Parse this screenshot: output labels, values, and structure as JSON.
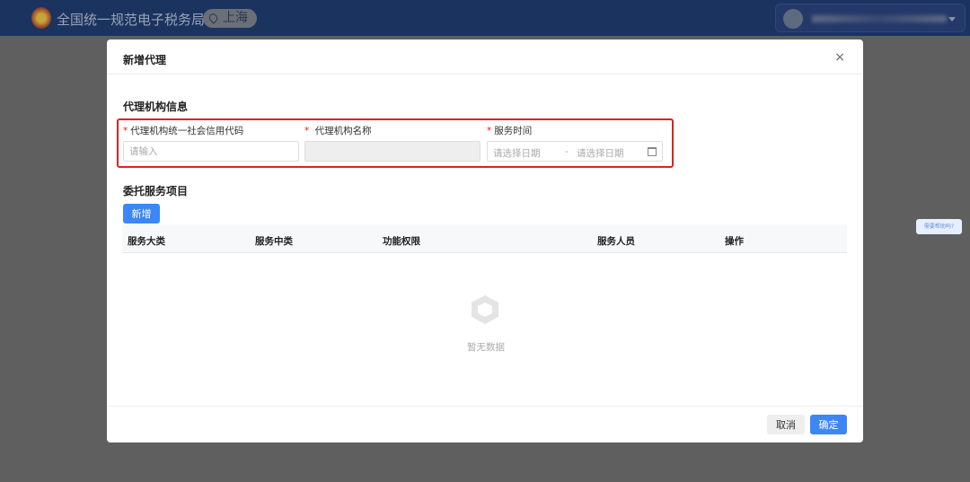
{
  "header": {
    "app_title": "全国统一规范电子税务局",
    "region": "上海",
    "user_name": ""
  },
  "modal": {
    "title": "新增代理",
    "close_label": "×",
    "agency_section": "代理机构信息",
    "fields": [
      {
        "label": "代理机构统一社会信用代码",
        "required": true,
        "placeholder": "请输入",
        "value": ""
      },
      {
        "label": "代理机构名称",
        "required": true,
        "value": "",
        "disabled": true
      },
      {
        "label": "服务时间",
        "required": true,
        "start_placeholder": "请选择日期",
        "separator": "-",
        "end_placeholder": "请选择日期"
      }
    ],
    "service_section": "委托服务项目",
    "add_button": "新增",
    "table": {
      "columns": [
        "服务大类",
        "服务中类",
        "功能权限",
        "服务人员",
        "操作"
      ],
      "rows": [],
      "empty_text": "暂无数据"
    },
    "cancel_button": "取消",
    "confirm_button": "确定"
  },
  "help_tooltip": "需要帮助吗?",
  "colors": {
    "header_bg": "#1b335f",
    "primary": "#3d86f5",
    "highlight_border": "#e02020"
  }
}
